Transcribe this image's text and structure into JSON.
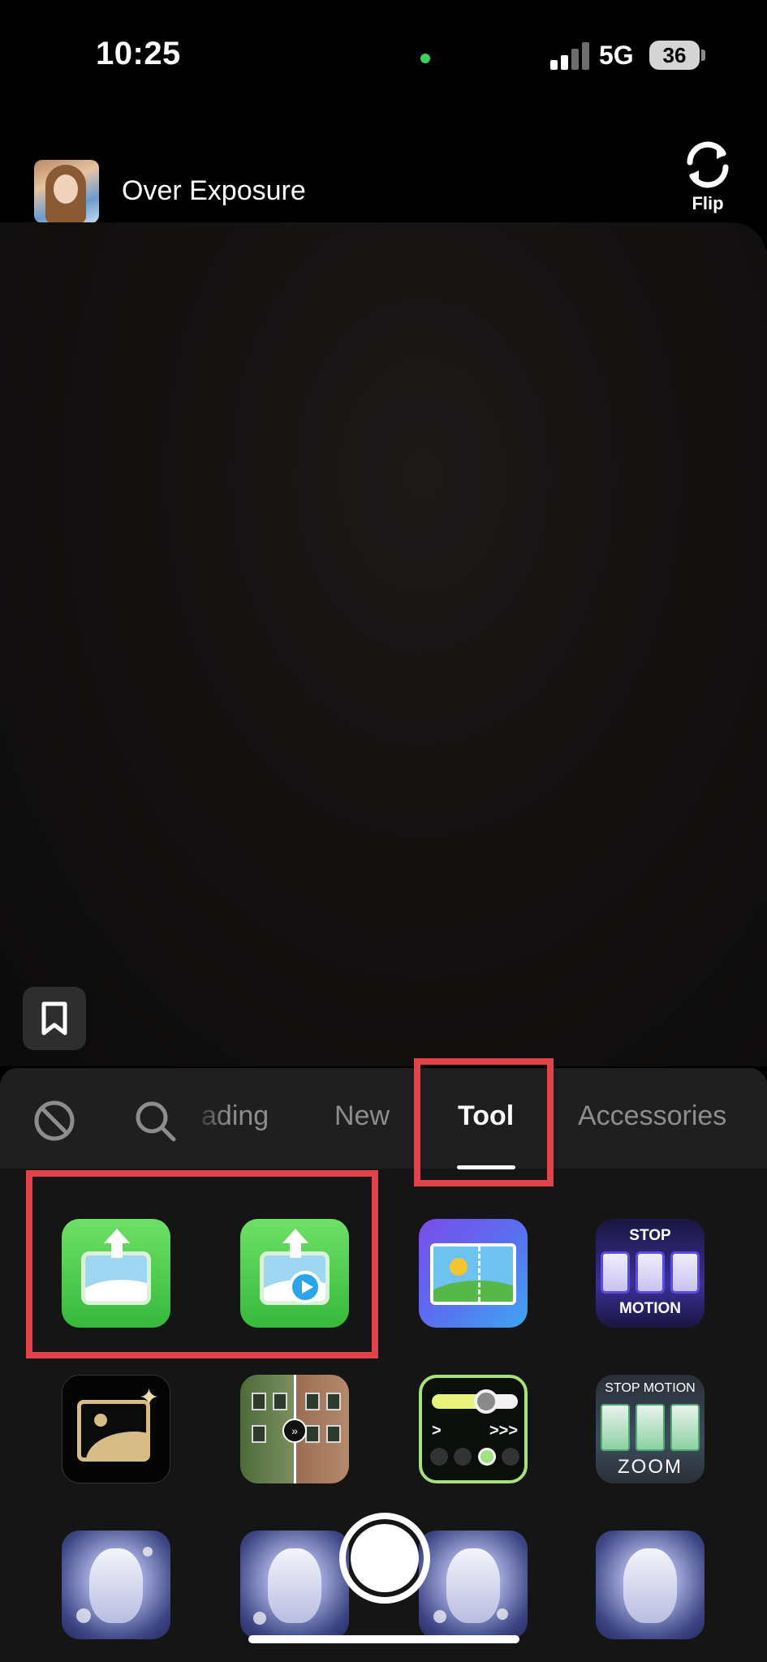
{
  "status_bar": {
    "time": "10:25",
    "network": "5G",
    "battery": "36"
  },
  "effect": {
    "title": "Over Exposure",
    "flip_label": "Flip"
  },
  "tabs": [
    {
      "label": "ading"
    },
    {
      "label": "New"
    },
    {
      "label": "Tool"
    },
    {
      "label": "Accessories"
    }
  ],
  "active_tab": "Tool",
  "tiles": {
    "stop_motion": {
      "line1": "STOP",
      "line2": "MOTION"
    },
    "stop_motion_zoom": {
      "line1": "STOP MOTION",
      "line2": "ZOOM"
    },
    "speed_arrows": {
      "left": ">",
      "right": ">>>"
    },
    "compare_knob": "»"
  },
  "colors": {
    "highlight": "#e2434b",
    "upload_green": "#36b93c"
  },
  "icons": [
    "no-effect-icon",
    "search-icon",
    "flip-camera-icon",
    "bookmark-icon"
  ]
}
